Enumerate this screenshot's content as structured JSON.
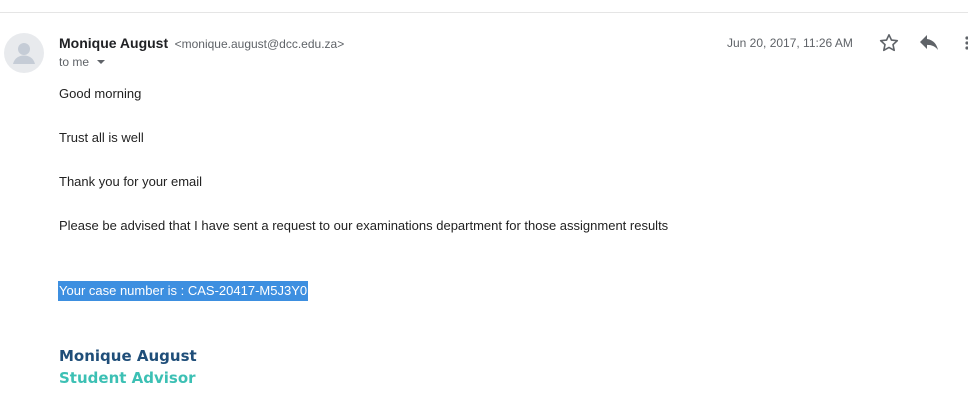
{
  "sender": {
    "name": "Monique August",
    "email": "<monique.august@dcc.edu.za>",
    "avatar_icon": "person-icon"
  },
  "recipient": {
    "label": "to me"
  },
  "date": "Jun 20, 2017, 11:26 AM",
  "actions": {
    "star_icon": "star-icon",
    "reply_icon": "reply-icon",
    "more_icon": "more-vert-icon"
  },
  "body": {
    "greeting": "Good morning",
    "line2": "Trust all is well",
    "line3": "Thank you for your email",
    "line4": "Please be advised that I have sent a request to our examinations department for those assignment results",
    "case_number": "Your case number is :  CAS-20417-M5J3Y0"
  },
  "signature": {
    "name": "Monique August",
    "title": "Student Advisor"
  },
  "colors": {
    "selection_highlight": "#3d8fe0",
    "signature_name": "#1f4e79",
    "signature_title": "#3cc0b4"
  }
}
